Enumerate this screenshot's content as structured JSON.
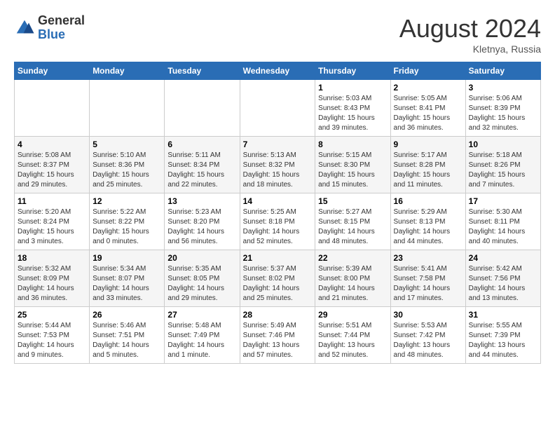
{
  "logo": {
    "general": "General",
    "blue": "Blue"
  },
  "title": {
    "month_year": "August 2024",
    "location": "Kletnya, Russia"
  },
  "days_of_week": [
    "Sunday",
    "Monday",
    "Tuesday",
    "Wednesday",
    "Thursday",
    "Friday",
    "Saturday"
  ],
  "weeks": [
    [
      {
        "day": "",
        "sunrise": "",
        "sunset": "",
        "daylight": ""
      },
      {
        "day": "",
        "sunrise": "",
        "sunset": "",
        "daylight": ""
      },
      {
        "day": "",
        "sunrise": "",
        "sunset": "",
        "daylight": ""
      },
      {
        "day": "",
        "sunrise": "",
        "sunset": "",
        "daylight": ""
      },
      {
        "day": "1",
        "sunrise": "Sunrise: 5:03 AM",
        "sunset": "Sunset: 8:43 PM",
        "daylight": "Daylight: 15 hours and 39 minutes."
      },
      {
        "day": "2",
        "sunrise": "Sunrise: 5:05 AM",
        "sunset": "Sunset: 8:41 PM",
        "daylight": "Daylight: 15 hours and 36 minutes."
      },
      {
        "day": "3",
        "sunrise": "Sunrise: 5:06 AM",
        "sunset": "Sunset: 8:39 PM",
        "daylight": "Daylight: 15 hours and 32 minutes."
      }
    ],
    [
      {
        "day": "4",
        "sunrise": "Sunrise: 5:08 AM",
        "sunset": "Sunset: 8:37 PM",
        "daylight": "Daylight: 15 hours and 29 minutes."
      },
      {
        "day": "5",
        "sunrise": "Sunrise: 5:10 AM",
        "sunset": "Sunset: 8:36 PM",
        "daylight": "Daylight: 15 hours and 25 minutes."
      },
      {
        "day": "6",
        "sunrise": "Sunrise: 5:11 AM",
        "sunset": "Sunset: 8:34 PM",
        "daylight": "Daylight: 15 hours and 22 minutes."
      },
      {
        "day": "7",
        "sunrise": "Sunrise: 5:13 AM",
        "sunset": "Sunset: 8:32 PM",
        "daylight": "Daylight: 15 hours and 18 minutes."
      },
      {
        "day": "8",
        "sunrise": "Sunrise: 5:15 AM",
        "sunset": "Sunset: 8:30 PM",
        "daylight": "Daylight: 15 hours and 15 minutes."
      },
      {
        "day": "9",
        "sunrise": "Sunrise: 5:17 AM",
        "sunset": "Sunset: 8:28 PM",
        "daylight": "Daylight: 15 hours and 11 minutes."
      },
      {
        "day": "10",
        "sunrise": "Sunrise: 5:18 AM",
        "sunset": "Sunset: 8:26 PM",
        "daylight": "Daylight: 15 hours and 7 minutes."
      }
    ],
    [
      {
        "day": "11",
        "sunrise": "Sunrise: 5:20 AM",
        "sunset": "Sunset: 8:24 PM",
        "daylight": "Daylight: 15 hours and 3 minutes."
      },
      {
        "day": "12",
        "sunrise": "Sunrise: 5:22 AM",
        "sunset": "Sunset: 8:22 PM",
        "daylight": "Daylight: 15 hours and 0 minutes."
      },
      {
        "day": "13",
        "sunrise": "Sunrise: 5:23 AM",
        "sunset": "Sunset: 8:20 PM",
        "daylight": "Daylight: 14 hours and 56 minutes."
      },
      {
        "day": "14",
        "sunrise": "Sunrise: 5:25 AM",
        "sunset": "Sunset: 8:18 PM",
        "daylight": "Daylight: 14 hours and 52 minutes."
      },
      {
        "day": "15",
        "sunrise": "Sunrise: 5:27 AM",
        "sunset": "Sunset: 8:15 PM",
        "daylight": "Daylight: 14 hours and 48 minutes."
      },
      {
        "day": "16",
        "sunrise": "Sunrise: 5:29 AM",
        "sunset": "Sunset: 8:13 PM",
        "daylight": "Daylight: 14 hours and 44 minutes."
      },
      {
        "day": "17",
        "sunrise": "Sunrise: 5:30 AM",
        "sunset": "Sunset: 8:11 PM",
        "daylight": "Daylight: 14 hours and 40 minutes."
      }
    ],
    [
      {
        "day": "18",
        "sunrise": "Sunrise: 5:32 AM",
        "sunset": "Sunset: 8:09 PM",
        "daylight": "Daylight: 14 hours and 36 minutes."
      },
      {
        "day": "19",
        "sunrise": "Sunrise: 5:34 AM",
        "sunset": "Sunset: 8:07 PM",
        "daylight": "Daylight: 14 hours and 33 minutes."
      },
      {
        "day": "20",
        "sunrise": "Sunrise: 5:35 AM",
        "sunset": "Sunset: 8:05 PM",
        "daylight": "Daylight: 14 hours and 29 minutes."
      },
      {
        "day": "21",
        "sunrise": "Sunrise: 5:37 AM",
        "sunset": "Sunset: 8:02 PM",
        "daylight": "Daylight: 14 hours and 25 minutes."
      },
      {
        "day": "22",
        "sunrise": "Sunrise: 5:39 AM",
        "sunset": "Sunset: 8:00 PM",
        "daylight": "Daylight: 14 hours and 21 minutes."
      },
      {
        "day": "23",
        "sunrise": "Sunrise: 5:41 AM",
        "sunset": "Sunset: 7:58 PM",
        "daylight": "Daylight: 14 hours and 17 minutes."
      },
      {
        "day": "24",
        "sunrise": "Sunrise: 5:42 AM",
        "sunset": "Sunset: 7:56 PM",
        "daylight": "Daylight: 14 hours and 13 minutes."
      }
    ],
    [
      {
        "day": "25",
        "sunrise": "Sunrise: 5:44 AM",
        "sunset": "Sunset: 7:53 PM",
        "daylight": "Daylight: 14 hours and 9 minutes."
      },
      {
        "day": "26",
        "sunrise": "Sunrise: 5:46 AM",
        "sunset": "Sunset: 7:51 PM",
        "daylight": "Daylight: 14 hours and 5 minutes."
      },
      {
        "day": "27",
        "sunrise": "Sunrise: 5:48 AM",
        "sunset": "Sunset: 7:49 PM",
        "daylight": "Daylight: 14 hours and 1 minute."
      },
      {
        "day": "28",
        "sunrise": "Sunrise: 5:49 AM",
        "sunset": "Sunset: 7:46 PM",
        "daylight": "Daylight: 13 hours and 57 minutes."
      },
      {
        "day": "29",
        "sunrise": "Sunrise: 5:51 AM",
        "sunset": "Sunset: 7:44 PM",
        "daylight": "Daylight: 13 hours and 52 minutes."
      },
      {
        "day": "30",
        "sunrise": "Sunrise: 5:53 AM",
        "sunset": "Sunset: 7:42 PM",
        "daylight": "Daylight: 13 hours and 48 minutes."
      },
      {
        "day": "31",
        "sunrise": "Sunrise: 5:55 AM",
        "sunset": "Sunset: 7:39 PM",
        "daylight": "Daylight: 13 hours and 44 minutes."
      }
    ]
  ]
}
